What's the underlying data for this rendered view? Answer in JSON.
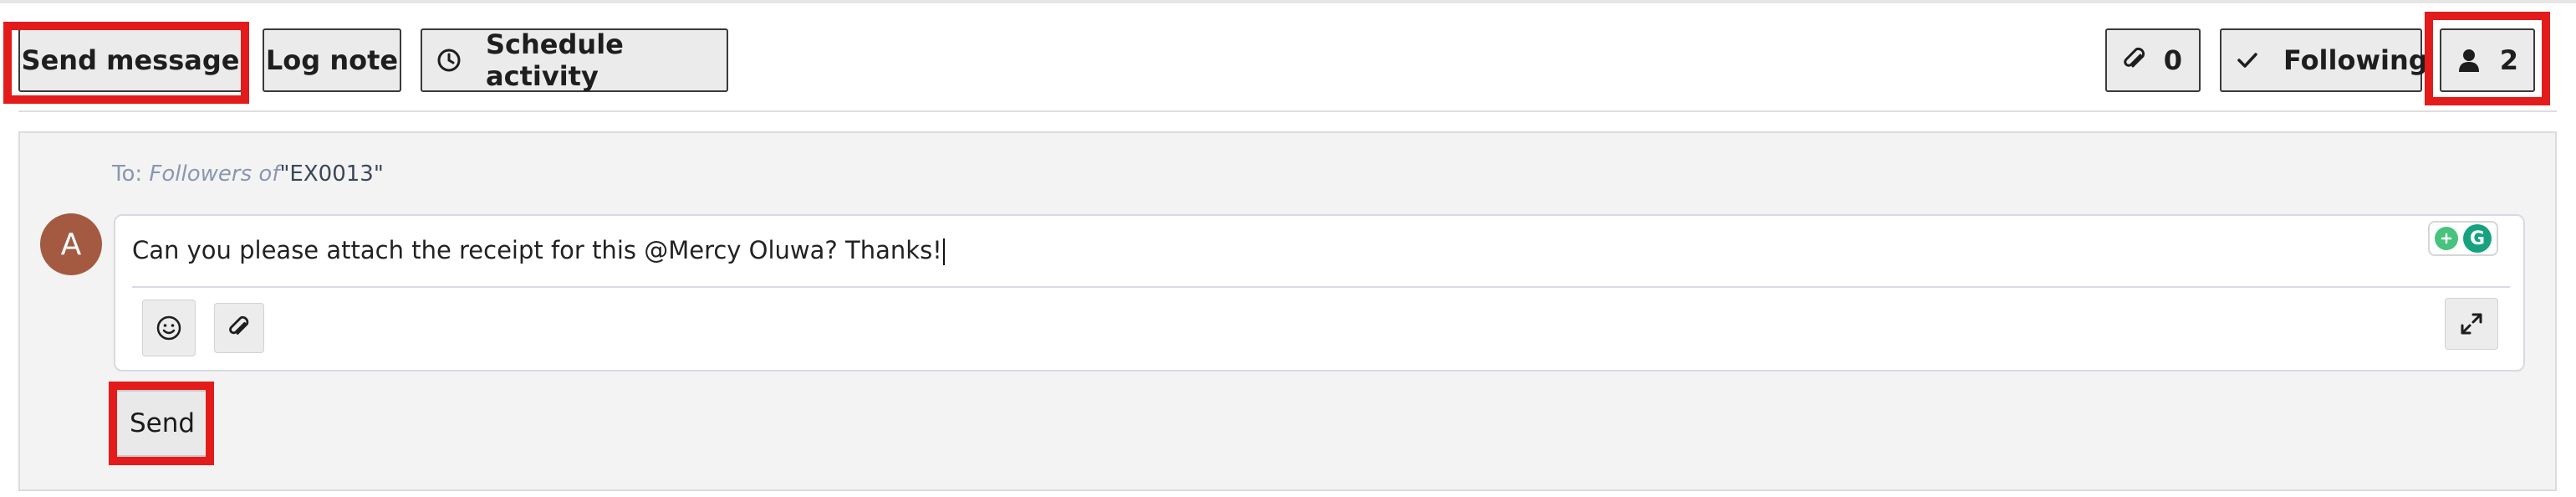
{
  "toolbar": {
    "send_message": "Send message",
    "log_note": "Log note",
    "schedule_activity": "Schedule activity",
    "attachments_count": "0",
    "following": "Following",
    "followers_count": "2"
  },
  "composer": {
    "to_prefix": "To:",
    "followers_of": "Followers of",
    "record": "\"EX0013\"",
    "avatar_letter": "A",
    "message": "Can you please attach the receipt for this @Mercy Oluwa? Thanks!",
    "send_label": "Send"
  },
  "icons": {
    "schedule": "clock-icon",
    "attachment": "paperclip-icon",
    "following": "check-icon",
    "followers": "person-icon",
    "emoji": "smiley-icon",
    "attach": "paperclip-icon",
    "expand": "expand-icon",
    "grammarly": "grammarly-icon"
  },
  "colors": {
    "highlight": "#e31b1b",
    "avatar": "#a45a41",
    "recipients_text": "#8a97b0",
    "grammarly": "#15a37f"
  }
}
